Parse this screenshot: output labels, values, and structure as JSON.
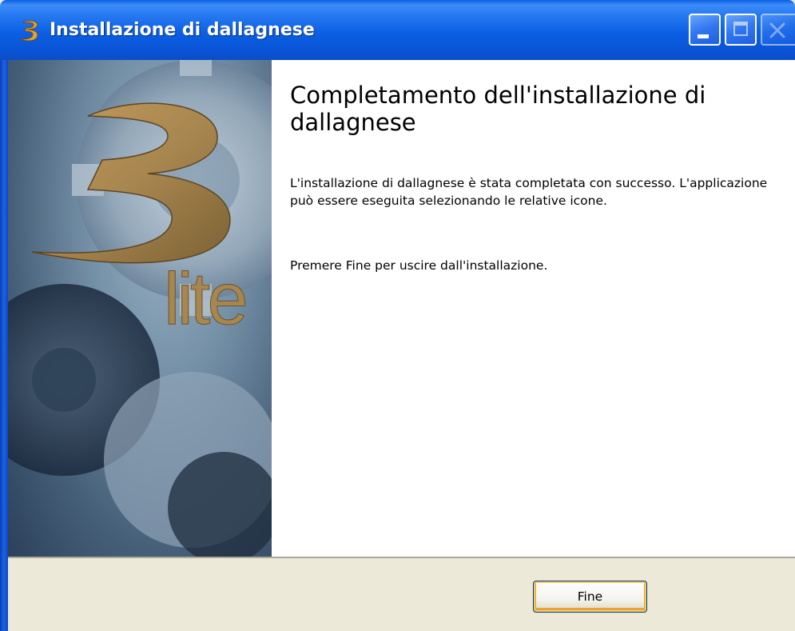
{
  "window": {
    "title": "Installazione di dallagnese"
  },
  "banner": {
    "logo_text": "lite",
    "logo_numeral": "3"
  },
  "content": {
    "heading": "Completamento dell'installazione di dallagnese",
    "paragraph_1": "L'installazione di dallagnese è stata completata con successo. L'applicazione può essere eseguita selezionando le relative icone.",
    "paragraph_2": "Premere Fine per uscire dall'installazione."
  },
  "footer": {
    "finish_label": "Fine"
  },
  "colors": {
    "titlebar": "#0b5fe3",
    "dialog_face": "#ece9d8",
    "logo_gold": "#a8864f"
  }
}
